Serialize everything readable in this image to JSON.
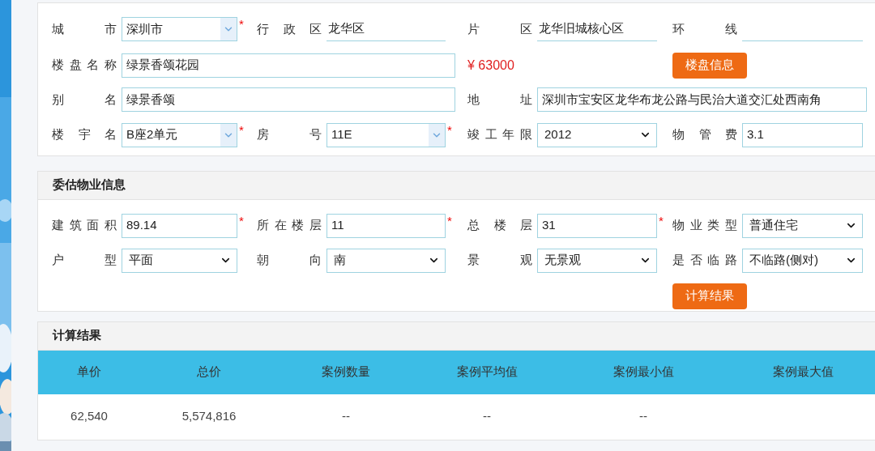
{
  "required_mark": "*",
  "property_form": {
    "rows": [
      [
        {
          "kind": "combo",
          "label": "城市",
          "value": "深圳市",
          "required": true
        },
        {
          "kind": "underline",
          "label": "行政区",
          "value": "龙华区",
          "required": false
        },
        {
          "kind": "underline",
          "label": "片区",
          "value": "龙华旧城核心区",
          "required": false
        },
        {
          "kind": "underline",
          "label": "环线",
          "required": false
        }
      ],
      [
        {
          "kind": "text",
          "colspan": 2,
          "label": "楼盘名称",
          "value": "绿景香颂花园",
          "required": false
        },
        {
          "kind": "price",
          "text": "¥ 63000"
        },
        {
          "kind": "button",
          "text": "楼盘信息"
        }
      ],
      [
        {
          "kind": "text",
          "colspan": 2,
          "label": "别名",
          "value": "绿景香颂",
          "required": false
        },
        {
          "kind": "text",
          "colspan": 2,
          "label": "地址",
          "value": "深圳市宝安区龙华布龙公路与民治大道交汇处西南角",
          "required": false
        }
      ],
      [
        {
          "kind": "combo",
          "label": "楼宇名",
          "value": "B座2单元",
          "required": true
        },
        {
          "kind": "combo",
          "label": "房号",
          "value": "11E",
          "required": true
        },
        {
          "kind": "select",
          "label": "竣工年限",
          "value": "2012",
          "required": false
        },
        {
          "kind": "text",
          "label": "物管费",
          "value": "3.1",
          "required": false
        }
      ]
    ]
  },
  "subject_property": {
    "title": "委估物业信息",
    "rows": [
      [
        {
          "kind": "text",
          "label": "建筑面积",
          "value": "89.14",
          "required": true
        },
        {
          "kind": "text",
          "label": "所在楼层",
          "value": "11",
          "required": true
        },
        {
          "kind": "text",
          "label": "总楼层",
          "value": "31",
          "required": true
        },
        {
          "kind": "select",
          "label": "物业类型",
          "value": "普通住宅",
          "required": false
        }
      ],
      [
        {
          "kind": "select",
          "label": "户型",
          "value": "平面",
          "required": false
        },
        {
          "kind": "select",
          "label": "朝向",
          "value": "南",
          "required": false
        },
        {
          "kind": "select",
          "label": "景观",
          "value": "无景观",
          "required": false
        },
        {
          "kind": "select",
          "label": "是否临路",
          "value": "不临路(侧对)",
          "required": false
        }
      ],
      [
        {
          "kind": "empty"
        },
        {
          "kind": "empty"
        },
        {
          "kind": "empty"
        },
        {
          "kind": "button",
          "text": "计算结果"
        }
      ]
    ]
  },
  "results": {
    "title": "计算结果",
    "columns": [
      "单价",
      "总价",
      "案例数量",
      "案例平均值",
      "案例最小值",
      "案例最大值"
    ],
    "rows": [
      [
        "62,540",
        "5,574,816",
        "--",
        "--",
        "--"
      ]
    ]
  }
}
